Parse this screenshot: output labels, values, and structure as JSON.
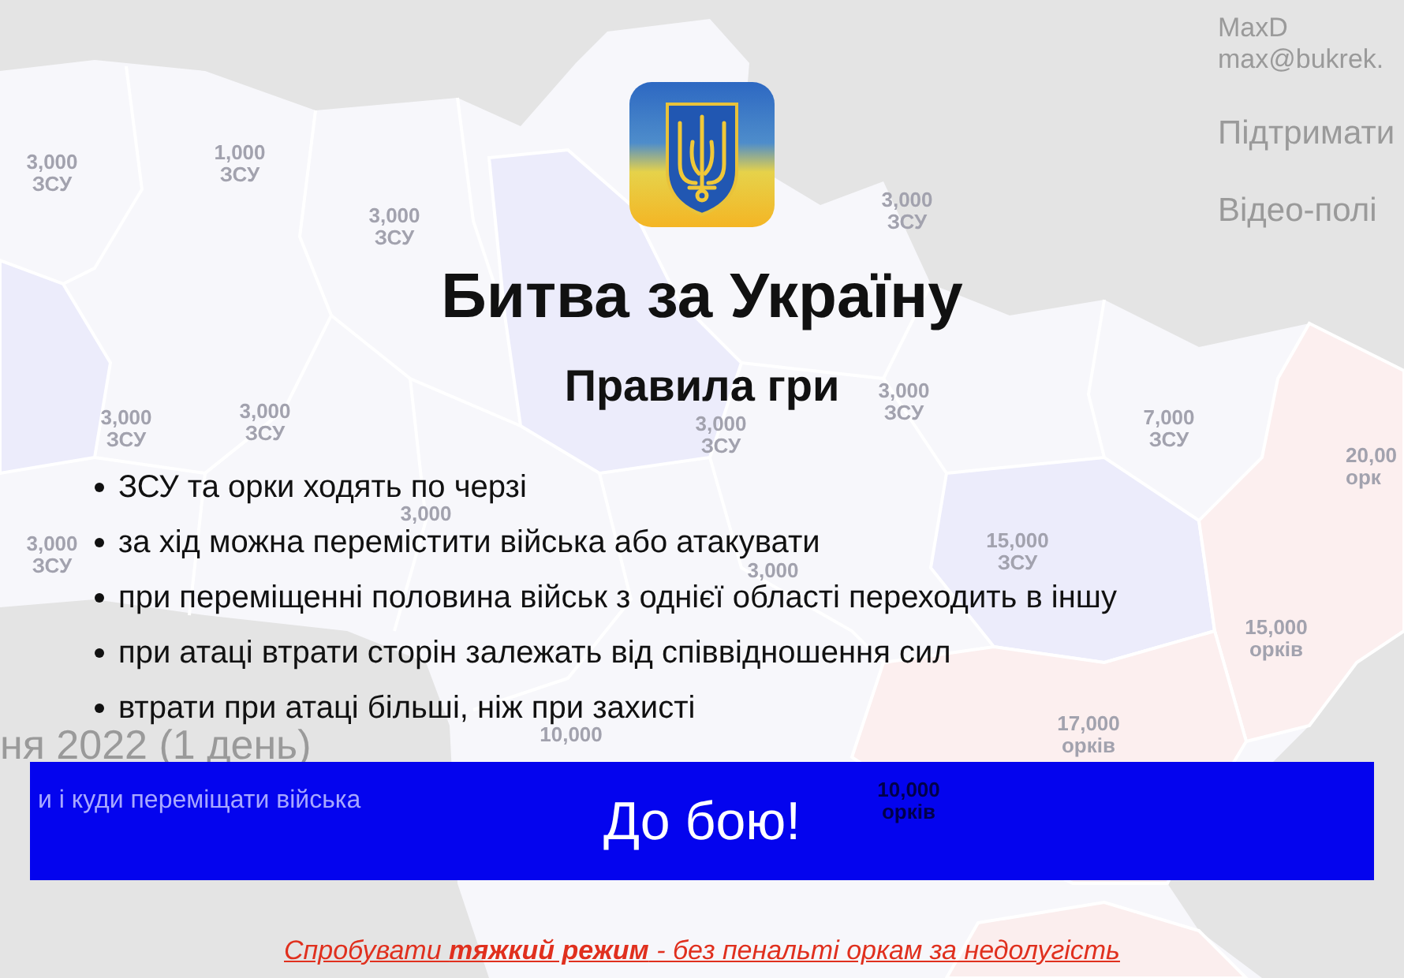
{
  "header": {
    "user_name": "MaxD",
    "user_email": "max@bukrek.",
    "links": [
      "Підтримати",
      "Відео-полі"
    ]
  },
  "map_labels": [
    {
      "count": "3,000",
      "unit": "ЗСУ"
    },
    {
      "count": "1,000",
      "unit": "ЗСУ"
    },
    {
      "count": "3,000",
      "unit": "ЗСУ"
    },
    {
      "count": "3,000",
      "unit": "ЗСУ"
    },
    {
      "count": "3,000",
      "unit": "ЗСУ"
    },
    {
      "count": "3,000",
      "unit": "ЗСУ"
    },
    {
      "count": "3,000",
      "unit": "ЗСУ"
    },
    {
      "count": "3,000",
      "unit": "ЗСУ"
    },
    {
      "count": "7,000",
      "unit": "ЗСУ"
    },
    {
      "count": "20,00",
      "unit": "орк"
    },
    {
      "count": "3,000"
    },
    {
      "count": "3,000",
      "unit": "ЗСУ"
    },
    {
      "count": "3,000"
    },
    {
      "count": "15,000",
      "unit": "ЗСУ"
    },
    {
      "count": "15,000",
      "unit": "орків"
    },
    {
      "count": "10,000"
    },
    {
      "count": "17,000",
      "unit": "орків"
    },
    {
      "count": "10,000",
      "unit": "орків"
    }
  ],
  "game_status": {
    "date": "ня 2022 (1 день)",
    "hint": "и і куди переміщати війська"
  },
  "rules_dialog": {
    "title": "Битва за Україну",
    "subtitle": "Правила гри",
    "rules": [
      "ЗСУ та орки ходять по черзі",
      "за хід можна перемістити війська або атакувати",
      "при переміщенні половина військ з однієї області переходить в іншу",
      "при атаці втрати сторін залежать від співвідношення сил",
      "втрати при атаці більші, ніж при захисті"
    ],
    "start_button": "До бою!",
    "hard_mode_link": "Спробувати **тяжкий режим** - без пенальті оркам за недолугість"
  }
}
